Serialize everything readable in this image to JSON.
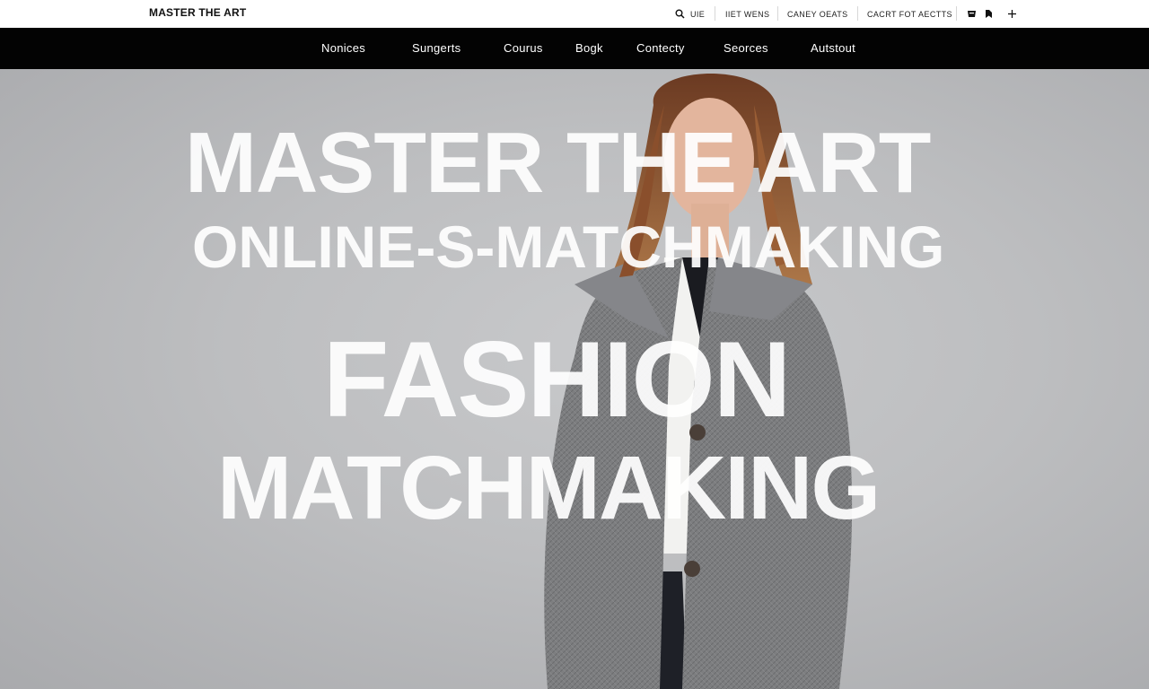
{
  "brand": {
    "name": "MASTER THE ART"
  },
  "utility": {
    "search_label": "UIE",
    "link1": "IIET WENS",
    "link2": "CANEY OEATS",
    "link3": "CACRT FOT AECTTS"
  },
  "icons": [
    "search-icon",
    "bag-icon",
    "bookmark-icon",
    "plus-icon"
  ],
  "nav": {
    "items": [
      "Nonices",
      "Sungerts",
      "Courus",
      "Bogk",
      "Contecty",
      "Seorces",
      "Autstout"
    ]
  },
  "hero": {
    "line1": "MASTER THE ART",
    "line2": "ONLINE-S-MATCHMAKING",
    "line3": "FASHION",
    "line4": "MATCHMAKING"
  },
  "colors": {
    "nav_bg": "#030303",
    "topbar_bg": "#ffffff",
    "hero_bg": "#bdbec0",
    "headline": "#ffffff",
    "coat": "#7b7c7e"
  }
}
